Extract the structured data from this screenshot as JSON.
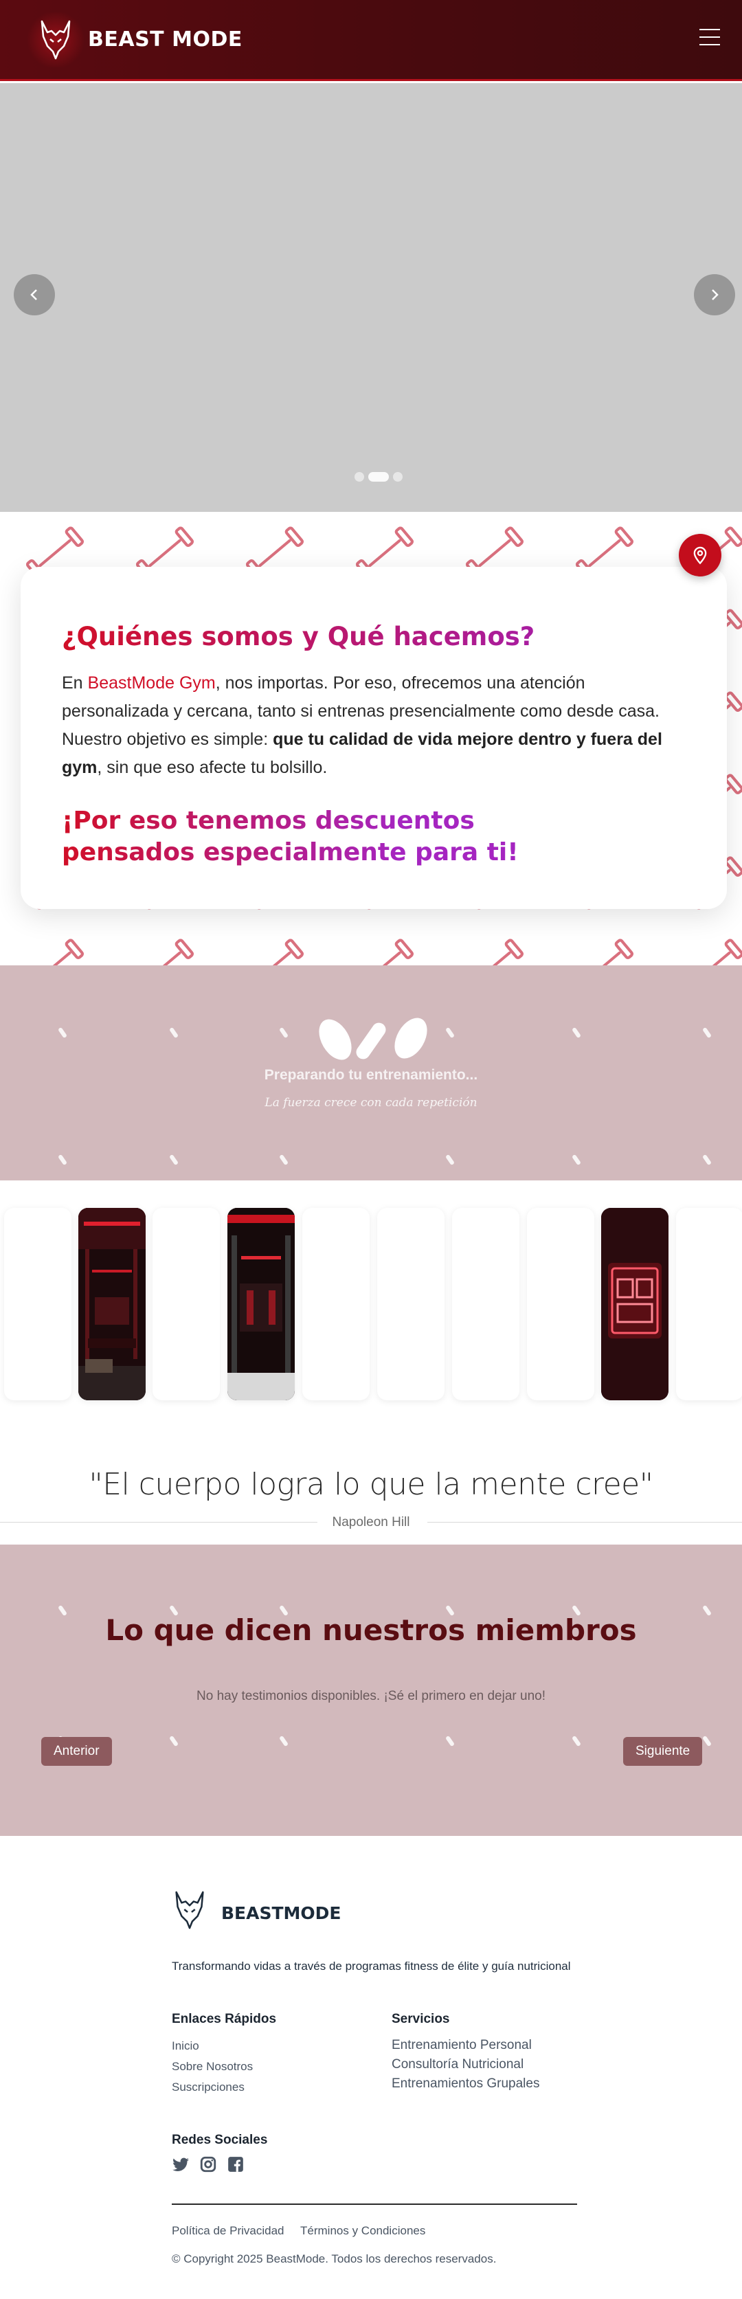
{
  "header": {
    "brand": "BEAST MODE"
  },
  "hero": {
    "slide_count": 3,
    "active_slide": 1
  },
  "about": {
    "title": "¿Quiénes somos y Qué hacemos?",
    "text_prefix": "En ",
    "gym_name": "BeastMode Gym",
    "text_middle": ", nos importas. Por eso, ofrecemos una atención personalizada y cercana, tanto si entrenas presencialmente como desde casa. Nuestro objetivo es simple: ",
    "text_bold": "que tu calidad de vida mejore dentro y fuera del gym",
    "text_suffix": ", sin que eso afecte tu bolsillo.",
    "subtitle": "¡Por eso tenemos descuentos pensados especialmente para ti!"
  },
  "loader": {
    "title": "Preparando tu entrenamiento...",
    "subtitle": "La fuerza crece con cada repetición"
  },
  "quote": {
    "text": "\"El cuerpo logra lo que la mente cree\"",
    "author": "Napoleon Hill"
  },
  "testimonials": {
    "title": "Lo que dicen nuestros miembros",
    "empty": "No hay testimonios disponibles. ¡Sé el primero en dejar uno!",
    "prev": "Anterior",
    "next": "Siguiente"
  },
  "footer": {
    "brand": "BEASTMODE",
    "tagline": "Transformando vidas a través de programas fitness de élite y guía nutricional",
    "quick_links_title": "Enlaces Rápidos",
    "quick_links": [
      "Inicio",
      "Sobre Nosotros",
      "Suscripciones"
    ],
    "services_title": "Servicios",
    "services": [
      "Entrenamiento Personal",
      "Consultoría Nutricional",
      "Entrenamientos Grupales"
    ],
    "social_title": "Redes Sociales",
    "social": [
      "twitter-icon",
      "instagram-icon",
      "facebook-icon"
    ],
    "privacy": "Política de Privacidad",
    "terms": "Términos y Condiciones",
    "copyright": "© Copyright 2025 BeastMode. Todos los derechos reservados."
  },
  "colors": {
    "header_bg": "#4a0a0e",
    "accent_red": "#d10f27",
    "accent_purple": "#9b22c8",
    "section_pink": "#d2b9bc",
    "dark_maroon": "#5a0d12"
  }
}
